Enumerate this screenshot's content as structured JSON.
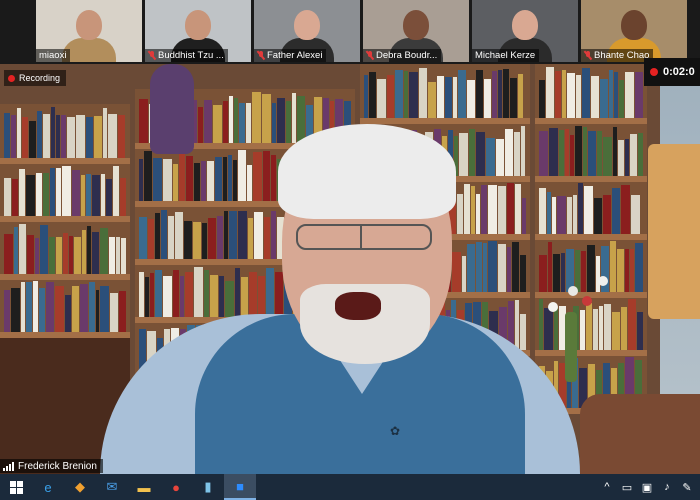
{
  "gallery": {
    "participants": [
      {
        "name": "miaoxi",
        "muted": false,
        "bg": "#d8d2c8",
        "skin": "#c8957a",
        "torso": "#b28e5c"
      },
      {
        "name": "Buddhist Tzu ...",
        "muted": true,
        "bg": "#bfc3c6",
        "skin": "#c8957a",
        "torso": "#1f1f1f"
      },
      {
        "name": "Father Alexei",
        "muted": true,
        "bg": "#8c8f93",
        "skin": "#d9a892",
        "torso": "#2c2c2c"
      },
      {
        "name": "Debra Boudr...",
        "muted": true,
        "bg": "#a99e94",
        "skin": "#7b4f3a",
        "torso": "#3b3b3b"
      },
      {
        "name": "Michael Kerze",
        "muted": false,
        "bg": "#5c5e62",
        "skin": "#d9a892",
        "torso": "#2b2b2b"
      },
      {
        "name": "Bhante Chao",
        "muted": true,
        "bg": "#a78d6a",
        "skin": "#6b432e",
        "torso": "#d89a2c"
      }
    ],
    "timer": "0:02:0"
  },
  "main": {
    "recording_label": "Recording",
    "speaker_name": "Frederick Brenion"
  },
  "taskbar": {
    "apps": [
      {
        "icon": "windows-start-icon"
      },
      {
        "icon": "edge-icon",
        "glyph": "e",
        "color": "#3aa0e8"
      },
      {
        "icon": "store-icon",
        "glyph": "◆",
        "color": "#f0a030"
      },
      {
        "icon": "mail-icon",
        "glyph": "✉",
        "color": "#4a9fe8"
      },
      {
        "icon": "folder-icon",
        "glyph": "▬",
        "color": "#f2c14e"
      },
      {
        "icon": "chrome-icon",
        "glyph": "●",
        "color": "#e8453c"
      },
      {
        "icon": "notes-icon",
        "glyph": "▮",
        "color": "#7fc4e8"
      },
      {
        "icon": "zoom-icon",
        "glyph": "■",
        "color": "#2d8cff"
      }
    ],
    "tray": [
      "chevron-up-icon",
      "network-icon",
      "display-icon",
      "volume-icon",
      "pen-icon"
    ]
  }
}
